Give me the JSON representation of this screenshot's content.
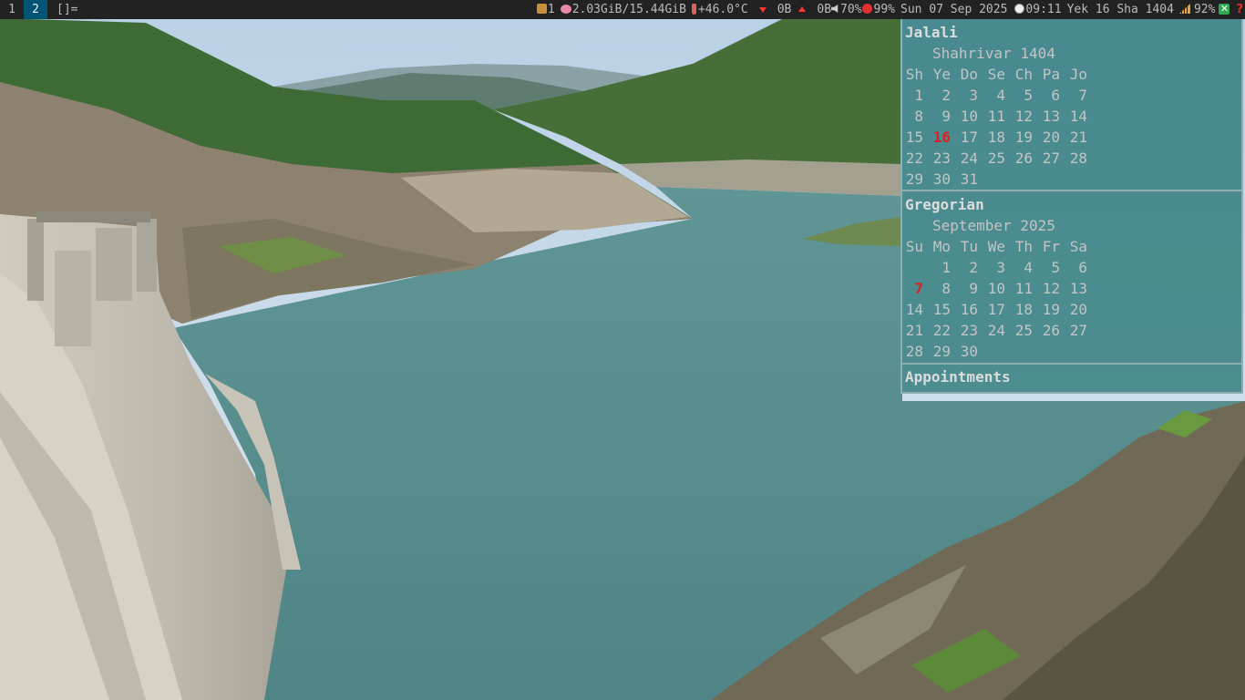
{
  "topbar": {
    "tags": [
      "1",
      "2"
    ],
    "active_tag": "2",
    "layout_symbol": "[]=",
    "updates": "1",
    "memory": "2.03GiB/15.44GiB",
    "temperature": "+46.0°C",
    "net_down": "0B",
    "net_up": "0B",
    "volume": "70%",
    "disk": "99%",
    "date": "Sun 07 Sep 2025",
    "time": "09:11",
    "jalali_date": "Yek 16 Sha 1404",
    "battery": "92%",
    "help_glyph": "?",
    "icons": [
      "package-icon",
      "brain-icon",
      "thermometer-icon",
      "down-arrow-icon",
      "up-arrow-icon",
      "speaker-icon",
      "red-circle-icon",
      "clock-icon",
      "wifi-icon",
      "battery-icon",
      "help-icon"
    ],
    "colors": {
      "bar_bg": "#222222",
      "active_tag_bg": "#005577",
      "text": "#bbbbbb"
    }
  },
  "calendar": {
    "jalali": {
      "title": "Jalali",
      "month": "Shahrivar 1404",
      "weekdays": [
        "Sh",
        "Ye",
        "Do",
        "Se",
        "Ch",
        "Pa",
        "Jo"
      ],
      "weeks": [
        [
          "1",
          "2",
          "3",
          "4",
          "5",
          "6",
          "7"
        ],
        [
          "8",
          "9",
          "10",
          "11",
          "12",
          "13",
          "14"
        ],
        [
          "15",
          "16",
          "17",
          "18",
          "19",
          "20",
          "21"
        ],
        [
          "22",
          "23",
          "24",
          "25",
          "26",
          "27",
          "28"
        ],
        [
          "29",
          "30",
          "31",
          "",
          "",
          "",
          ""
        ]
      ],
      "today": "16"
    },
    "gregorian": {
      "title": "Gregorian",
      "month": "September 2025",
      "weekdays": [
        "Su",
        "Mo",
        "Tu",
        "We",
        "Th",
        "Fr",
        "Sa"
      ],
      "weeks": [
        [
          "",
          "1",
          "2",
          "3",
          "4",
          "5",
          "6"
        ],
        [
          "7",
          "8",
          "9",
          "10",
          "11",
          "12",
          "13"
        ],
        [
          "14",
          "15",
          "16",
          "17",
          "18",
          "19",
          "20"
        ],
        [
          "21",
          "22",
          "23",
          "24",
          "25",
          "26",
          "27"
        ],
        [
          "28",
          "29",
          "30",
          "",
          "",
          "",
          ""
        ]
      ],
      "today": "7"
    },
    "appointments_label": "Appointments",
    "colors": {
      "today": "#e02020",
      "panel_bg": "#287676",
      "border": "#8fb0b0"
    }
  }
}
